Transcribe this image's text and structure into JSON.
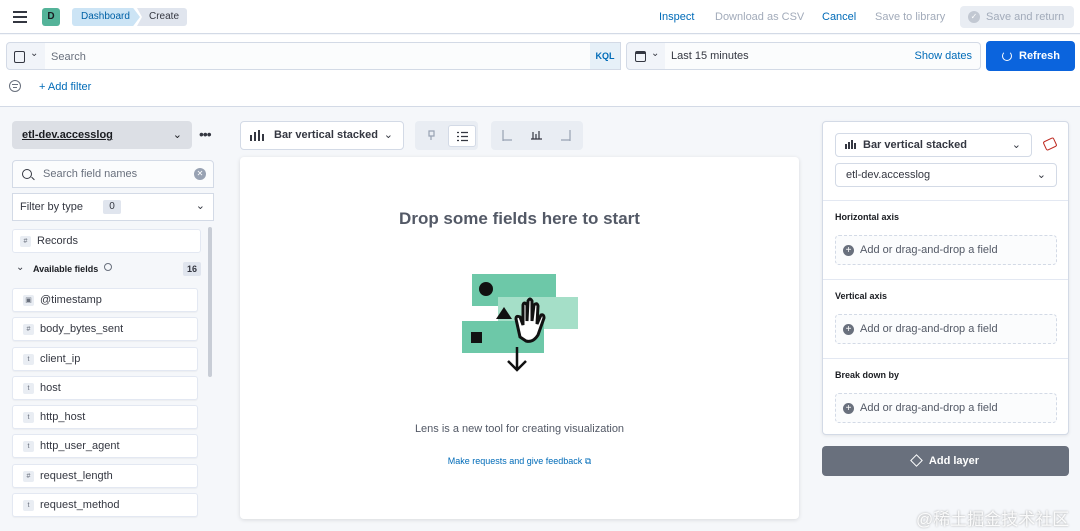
{
  "header": {
    "space_initial": "D",
    "breadcrumbs": [
      "Dashboard",
      "Create"
    ],
    "links": {
      "inspect": "Inspect",
      "download_csv": "Download as CSV",
      "cancel": "Cancel",
      "save_to_library": "Save to library",
      "save_and_return": "Save and return"
    }
  },
  "query_bar": {
    "search_placeholder": "Search",
    "language": "KQL",
    "time_range": "Last 15 minutes",
    "show_dates": "Show dates",
    "refresh_label": "Refresh",
    "add_filter": "+ Add filter"
  },
  "sidebar": {
    "index_pattern": "etl-dev.accesslog",
    "search_placeholder": "Search field names",
    "filter_by_type": "Filter by type",
    "filter_count": "0",
    "records_label": "Records",
    "available_fields_label": "Available fields",
    "available_fields_count": "16",
    "fields": [
      {
        "name": "@timestamp",
        "type": "date"
      },
      {
        "name": "body_bytes_sent",
        "type": "number"
      },
      {
        "name": "client_ip",
        "type": "string"
      },
      {
        "name": "host",
        "type": "string"
      },
      {
        "name": "http_host",
        "type": "string"
      },
      {
        "name": "http_user_agent",
        "type": "string"
      },
      {
        "name": "request_length",
        "type": "number"
      },
      {
        "name": "request_method",
        "type": "string"
      }
    ]
  },
  "workspace": {
    "chart_type": "Bar vertical stacked",
    "drop_title": "Drop some fields here to start",
    "description": "Lens is a new tool for creating visualization",
    "feedback_link": "Make requests and give feedback"
  },
  "config_panel": {
    "chart_type": "Bar vertical stacked",
    "index_pattern": "etl-dev.accesslog",
    "sections": [
      {
        "title": "Horizontal axis",
        "placeholder": "Add or drag-and-drop a field"
      },
      {
        "title": "Vertical axis",
        "placeholder": "Add or drag-and-drop a field"
      },
      {
        "title": "Break down by",
        "placeholder": "Add or drag-and-drop a field"
      }
    ],
    "add_layer": "Add layer"
  },
  "watermark": "@稀土掘金技术社区",
  "colors": {
    "primary": "#0b64dd",
    "link": "#006bb8",
    "space_badge": "#54b399",
    "illustration_green": "#6dc8a8",
    "add_layer_bg": "#69707d"
  },
  "icons": {
    "field_type_tokens": {
      "date": "▣",
      "number": "#",
      "string": "t"
    }
  }
}
